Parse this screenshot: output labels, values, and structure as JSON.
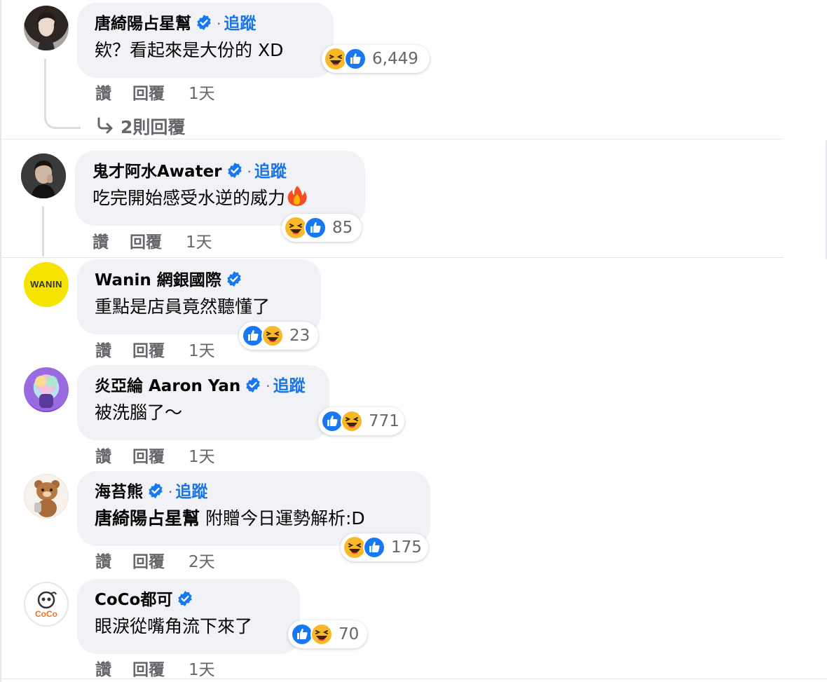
{
  "actions": {
    "like": "讚",
    "reply": "回覆"
  },
  "follow_label": "追蹤",
  "colors": {
    "bubble": "#f0f2f5",
    "link_blue": "#1b74e4",
    "meta_gray": "#65676b",
    "like_blue": "#1877f2",
    "haha_yellow": "#f7b928"
  },
  "comments": [
    {
      "name": "唐綺陽占星幫",
      "verified": true,
      "follow": true,
      "text": "欸？看起來是大份的 XD",
      "reactions": [
        "haha",
        "like"
      ],
      "count": "6,449",
      "time": "1天",
      "replies": "2則回覆"
    },
    {
      "name": "鬼才阿水Awater",
      "verified": true,
      "follow": true,
      "text": "吃完開始感受水逆的威力",
      "emoji": "fire-icon",
      "reactions": [
        "haha",
        "like"
      ],
      "count": "85",
      "time": "1天"
    },
    {
      "name": "Wanin 網銀國際",
      "verified": true,
      "follow": false,
      "avatar_text": "WANIN",
      "text": "重點是店員竟然聽懂了",
      "reactions": [
        "like",
        "haha"
      ],
      "count": "23",
      "time": "1天"
    },
    {
      "name": "炎亞綸 Aaron Yan",
      "verified": true,
      "follow": true,
      "text": "被洗腦了～",
      "reactions": [
        "like",
        "haha"
      ],
      "count": "771",
      "time": "1天"
    },
    {
      "name": "海苔熊",
      "verified": true,
      "follow": true,
      "mention": "唐綺陽占星幫",
      "text": "附贈今日運勢解析:D",
      "reactions": [
        "haha",
        "like"
      ],
      "count": "175",
      "time": "2天"
    },
    {
      "name": "CoCo都可",
      "verified": true,
      "follow": false,
      "avatar_text": "CoCo",
      "text": "眼淚從嘴角流下來了",
      "reactions": [
        "like",
        "haha"
      ],
      "count": "70",
      "time": "1天"
    }
  ]
}
